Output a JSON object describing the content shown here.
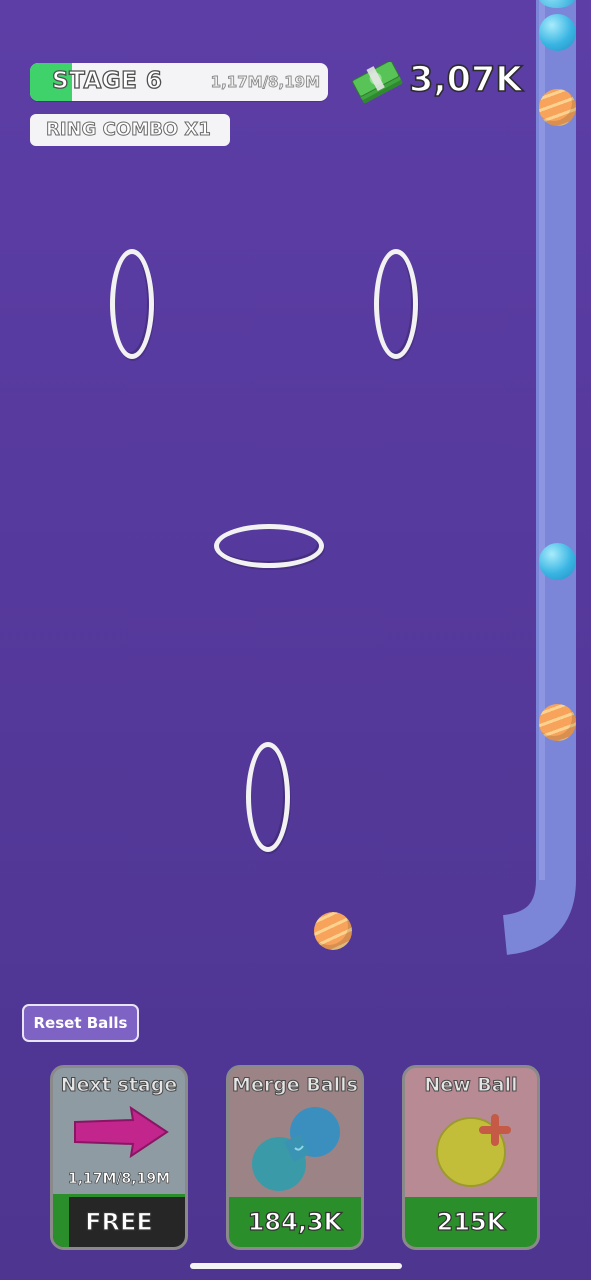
{
  "hud": {
    "stage_label": "STAGE 6",
    "stage_progress_text": "1,17M/8,19M",
    "stage_progress_fraction": 0.14,
    "ring_combo_label": "RING COMBO X1",
    "money_value": "3,07K",
    "money_icon": "cash-stack-icon"
  },
  "controls": {
    "reset_label": "Reset Balls"
  },
  "cards": [
    {
      "title": "Next stage",
      "subtitle": "1,17M/8,19M",
      "price": "FREE",
      "icon": "arrow-right-icon"
    },
    {
      "title": "Merge Balls",
      "subtitle": "",
      "price": "184,3K",
      "icon": "merge-balls-icon"
    },
    {
      "title": "New Ball",
      "subtitle": "",
      "price": "215K",
      "icon": "add-ball-icon"
    }
  ],
  "colors": {
    "background": "#56399c",
    "progress_green": "#3fd16a",
    "price_green": "#2a8f2a",
    "ball_orange": "#f59a4e",
    "ball_blue": "#3fb8e2",
    "tube": "#7b84d8"
  }
}
